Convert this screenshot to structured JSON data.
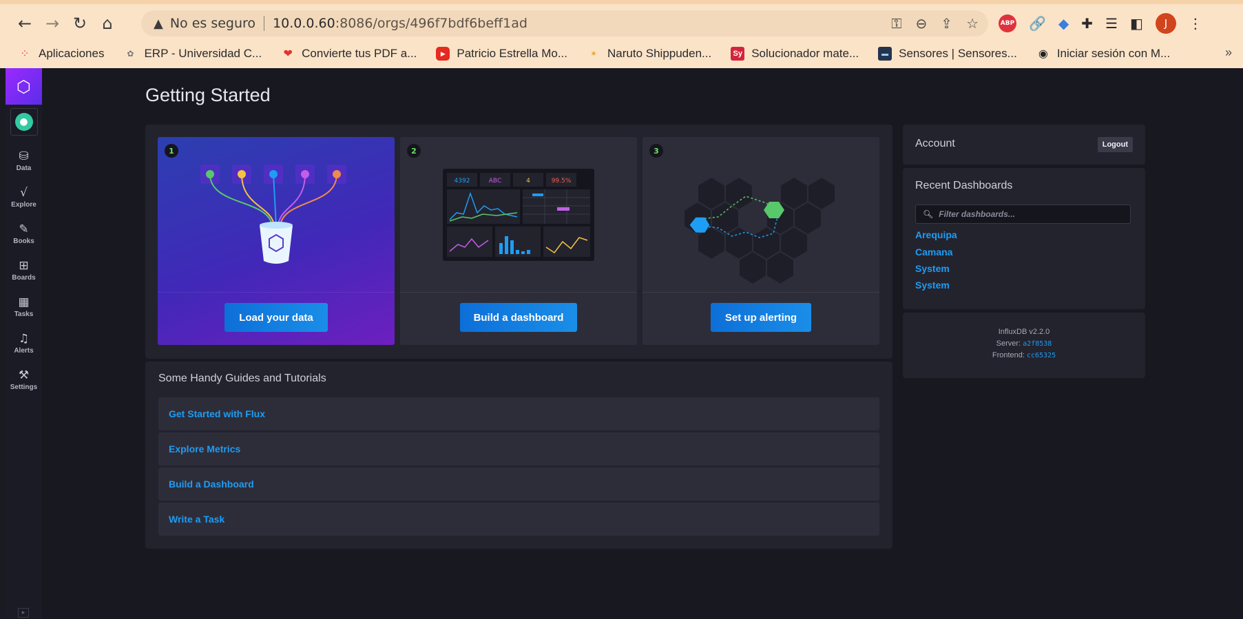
{
  "browser": {
    "insecure_label": "No es seguro",
    "url_host": "10.0.0.60",
    "url_rest": ":8086/orgs/496f7bdf6beff1ad",
    "profile_initial": "J",
    "abp_label": "ABP",
    "bookmarks": [
      {
        "label": "Aplicaciones",
        "icon": "apps-grid-icon"
      },
      {
        "label": "ERP - Universidad C...",
        "icon": "erp-icon"
      },
      {
        "label": "Convierte tus PDF a...",
        "icon": "heart-icon"
      },
      {
        "label": "Patricio Estrella Mo...",
        "icon": "youtube-icon"
      },
      {
        "label": "Naruto Shippuden...",
        "icon": "naruto-icon"
      },
      {
        "label": "Solucionador mate...",
        "icon": "sy-icon",
        "icon_text": "Sy"
      },
      {
        "label": "Sensores | Sensores...",
        "icon": "sensor-icon"
      },
      {
        "label": "Iniciar sesión con M...",
        "icon": "globe-icon"
      }
    ],
    "more": "»"
  },
  "nav": {
    "items": [
      {
        "label": "Data",
        "icon": "database-icon"
      },
      {
        "label": "Explore",
        "icon": "graph-icon"
      },
      {
        "label": "Books",
        "icon": "notebook-icon"
      },
      {
        "label": "Boards",
        "icon": "dashboards-icon"
      },
      {
        "label": "Tasks",
        "icon": "calendar-icon"
      },
      {
        "label": "Alerts",
        "icon": "bell-icon"
      },
      {
        "label": "Settings",
        "icon": "wrench-icon"
      }
    ]
  },
  "main": {
    "title": "Getting Started",
    "cards": [
      {
        "num": "1",
        "button": "Load your data"
      },
      {
        "num": "2",
        "button": "Build a dashboard"
      },
      {
        "num": "3",
        "button": "Set up alerting"
      }
    ],
    "dashboard_illustration": {
      "stats": [
        "4392",
        "ABC",
        "4",
        "99.5%"
      ]
    },
    "guides_title": "Some Handy Guides and Tutorials",
    "guides": [
      "Get Started with Flux",
      "Explore Metrics",
      "Build a Dashboard",
      "Write a Task"
    ]
  },
  "sidebar": {
    "account_title": "Account",
    "logout": "Logout",
    "recent_title": "Recent Dashboards",
    "filter_placeholder": "Filter dashboards...",
    "dashboards": [
      "Arequipa",
      "Camana",
      "System",
      "System"
    ],
    "version": "InfluxDB v2.2.0",
    "server_label": "Server:",
    "server": "a2f8538",
    "frontend_label": "Frontend:",
    "frontend": "cc65325"
  },
  "colors": {
    "accent": "#1e9df4",
    "brand": "#9b2aff",
    "success": "#71e068"
  }
}
